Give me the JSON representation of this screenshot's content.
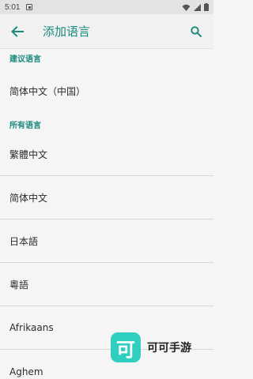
{
  "status_bar": {
    "time": "5:01",
    "icons": [
      "notification-app-icon",
      "wifi-icon",
      "signal-icon",
      "battery-icon"
    ]
  },
  "app_bar": {
    "title": "添加语言",
    "back_icon": "arrow-left-icon",
    "search_icon": "search-icon",
    "accent_color": "#1a8a7e"
  },
  "sections": {
    "suggested_header": "建议语言",
    "suggested_items": [
      "简体中文（中国）"
    ],
    "all_header": "所有语言",
    "all_items": [
      "繁體中文",
      "简体中文",
      "日本語",
      "粵語",
      "Afrikaans",
      "Aghem"
    ]
  },
  "watermark": {
    "icon_char": "可",
    "text": "可可手游",
    "color": "#2ecfc0"
  }
}
